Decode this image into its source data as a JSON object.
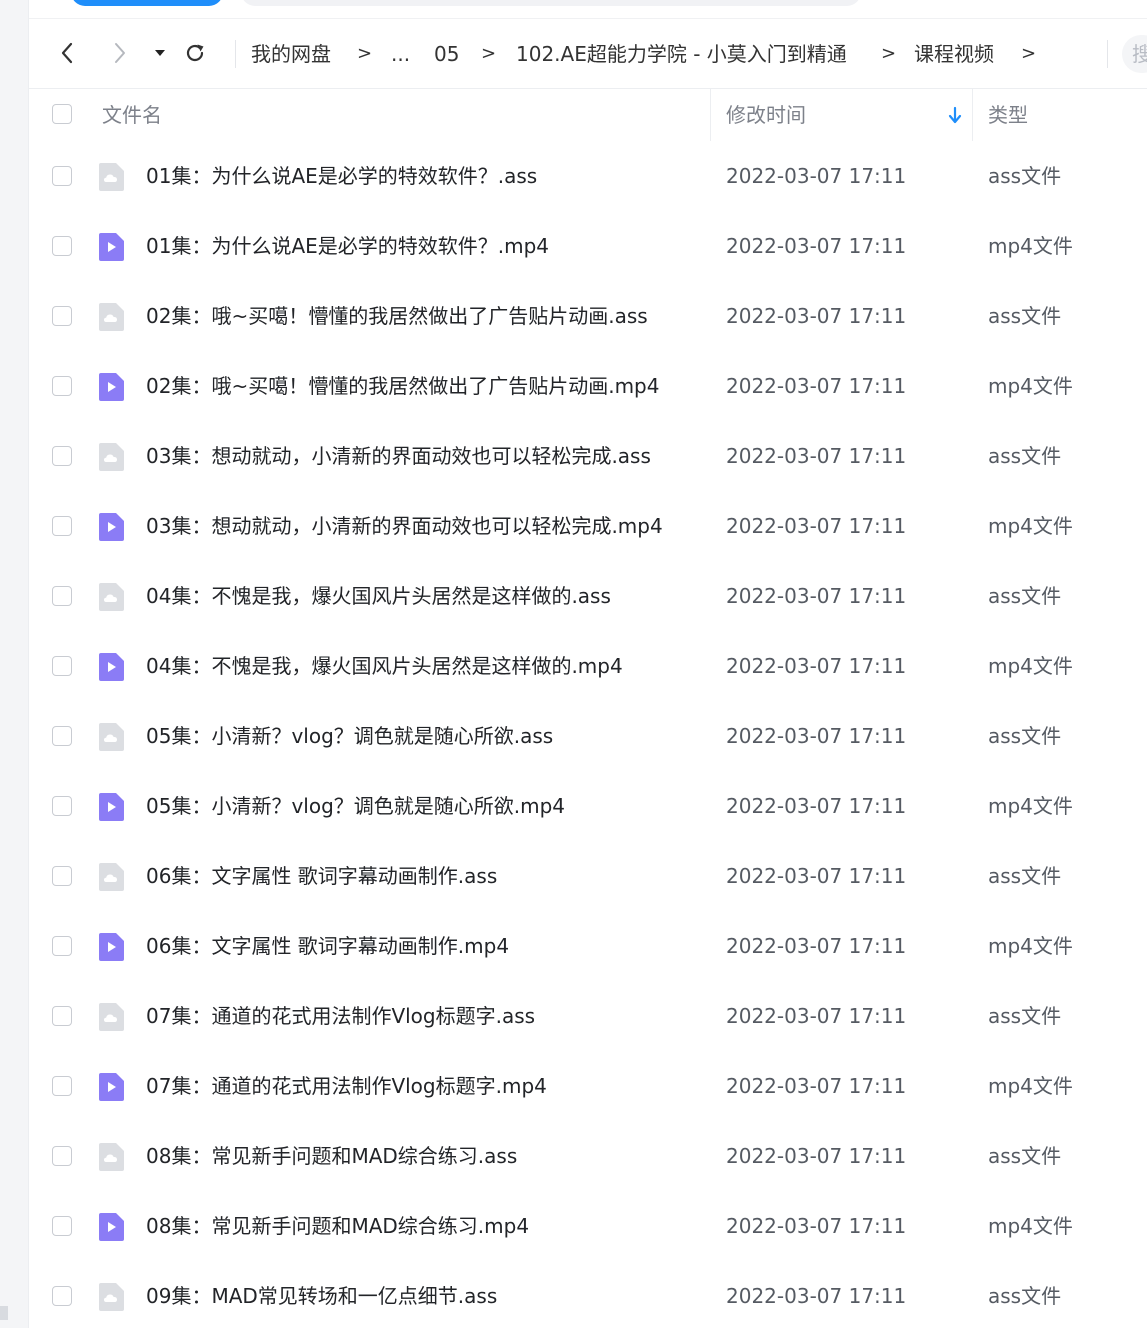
{
  "navigation": {
    "back_icon": "chevron-left-icon",
    "forward_icon": "chevron-right-icon",
    "dropdown_icon": "caret-down-icon",
    "refresh_icon": "refresh-icon",
    "breadcrumbs": [
      "我的网盘",
      "...",
      "05",
      "102.AE超能力学院 - 小莫入门到精通",
      "课程视频"
    ],
    "separator": ">",
    "search_placeholder": "搜"
  },
  "table": {
    "columns": {
      "name": "文件名",
      "modified": "修改时间",
      "type": "类型"
    },
    "sort_indicator": "arrow-down-icon",
    "accent_color": "#1f8efa",
    "rows": [
      {
        "name": "01集：为什么说AE是必学的特效软件？.ass",
        "date": "2022-03-07 17:11",
        "type": "ass文件",
        "icon": "document-icon"
      },
      {
        "name": "01集：为什么说AE是必学的特效软件？.mp4",
        "date": "2022-03-07 17:11",
        "type": "mp4文件",
        "icon": "video-icon"
      },
      {
        "name": "02集：哦~买噶！懵懂的我居然做出了广告贴片动画.ass",
        "date": "2022-03-07 17:11",
        "type": "ass文件",
        "icon": "document-icon"
      },
      {
        "name": "02集：哦~买噶！懵懂的我居然做出了广告贴片动画.mp4",
        "date": "2022-03-07 17:11",
        "type": "mp4文件",
        "icon": "video-icon"
      },
      {
        "name": "03集：想动就动，小清新的界面动效也可以轻松完成.ass",
        "date": "2022-03-07 17:11",
        "type": "ass文件",
        "icon": "document-icon"
      },
      {
        "name": "03集：想动就动，小清新的界面动效也可以轻松完成.mp4",
        "date": "2022-03-07 17:11",
        "type": "mp4文件",
        "icon": "video-icon"
      },
      {
        "name": "04集：不愧是我，爆火国风片头居然是这样做的.ass",
        "date": "2022-03-07 17:11",
        "type": "ass文件",
        "icon": "document-icon"
      },
      {
        "name": "04集：不愧是我，爆火国风片头居然是这样做的.mp4",
        "date": "2022-03-07 17:11",
        "type": "mp4文件",
        "icon": "video-icon"
      },
      {
        "name": "05集：小清新？vlog？调色就是随心所欲.ass",
        "date": "2022-03-07 17:11",
        "type": "ass文件",
        "icon": "document-icon"
      },
      {
        "name": "05集：小清新？vlog？调色就是随心所欲.mp4",
        "date": "2022-03-07 17:11",
        "type": "mp4文件",
        "icon": "video-icon"
      },
      {
        "name": "06集：文字属性 歌词字幕动画制作.ass",
        "date": "2022-03-07 17:11",
        "type": "ass文件",
        "icon": "document-icon"
      },
      {
        "name": "06集：文字属性 歌词字幕动画制作.mp4",
        "date": "2022-03-07 17:11",
        "type": "mp4文件",
        "icon": "video-icon"
      },
      {
        "name": "07集：通道的花式用法制作Vlog标题字.ass",
        "date": "2022-03-07 17:11",
        "type": "ass文件",
        "icon": "document-icon"
      },
      {
        "name": "07集：通道的花式用法制作Vlog标题字.mp4",
        "date": "2022-03-07 17:11",
        "type": "mp4文件",
        "icon": "video-icon"
      },
      {
        "name": "08集：常见新手问题和MAD综合练习.ass",
        "date": "2022-03-07 17:11",
        "type": "ass文件",
        "icon": "document-icon"
      },
      {
        "name": "08集：常见新手问题和MAD综合练习.mp4",
        "date": "2022-03-07 17:11",
        "type": "mp4文件",
        "icon": "video-icon"
      },
      {
        "name": "09集：MAD常见转场和一亿点细节.ass",
        "date": "2022-03-07 17:11",
        "type": "ass文件",
        "icon": "document-icon"
      }
    ]
  },
  "colors": {
    "video_icon": "#8b7cf6",
    "document_icon": "#dcdee2"
  }
}
